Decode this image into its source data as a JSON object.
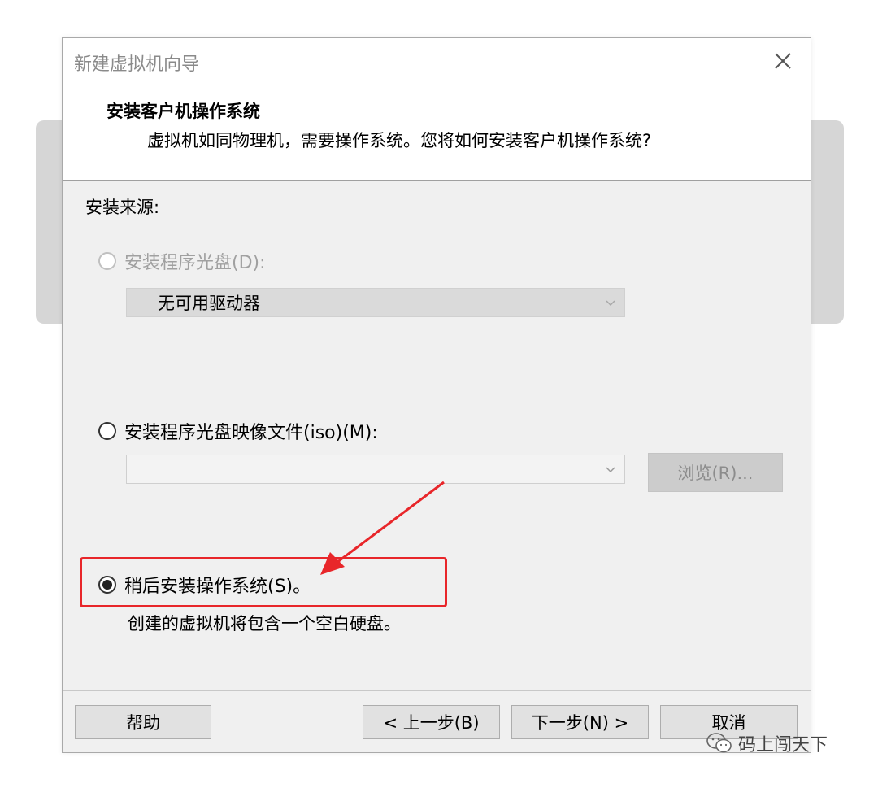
{
  "window": {
    "title": "新建虚拟机向导"
  },
  "header": {
    "title": "安装客户机操作系统",
    "subtitle": "虚拟机如同物理机，需要操作系统。您将如何安装客户机操作系统?"
  },
  "install_source": {
    "label": "安装来源:",
    "option_disc": {
      "label": "安装程序光盘(D):",
      "selected": false,
      "enabled": false,
      "drive_value": "无可用驱动器"
    },
    "option_iso": {
      "label": "安装程序光盘映像文件(iso)(M):",
      "selected": false,
      "enabled": true,
      "path_value": "",
      "browse_label": "浏览(R)..."
    },
    "option_later": {
      "label": "稍后安装操作系统(S)。",
      "selected": true,
      "description": "创建的虚拟机将包含一个空白硬盘。"
    }
  },
  "footer": {
    "help_label": "帮助",
    "back_label": "< 上一步(B)",
    "next_label": "下一步(N) >",
    "cancel_label": "取消"
  },
  "watermark": {
    "text": "码上闯天下"
  },
  "colors": {
    "annotation_red": "#e8262a"
  }
}
